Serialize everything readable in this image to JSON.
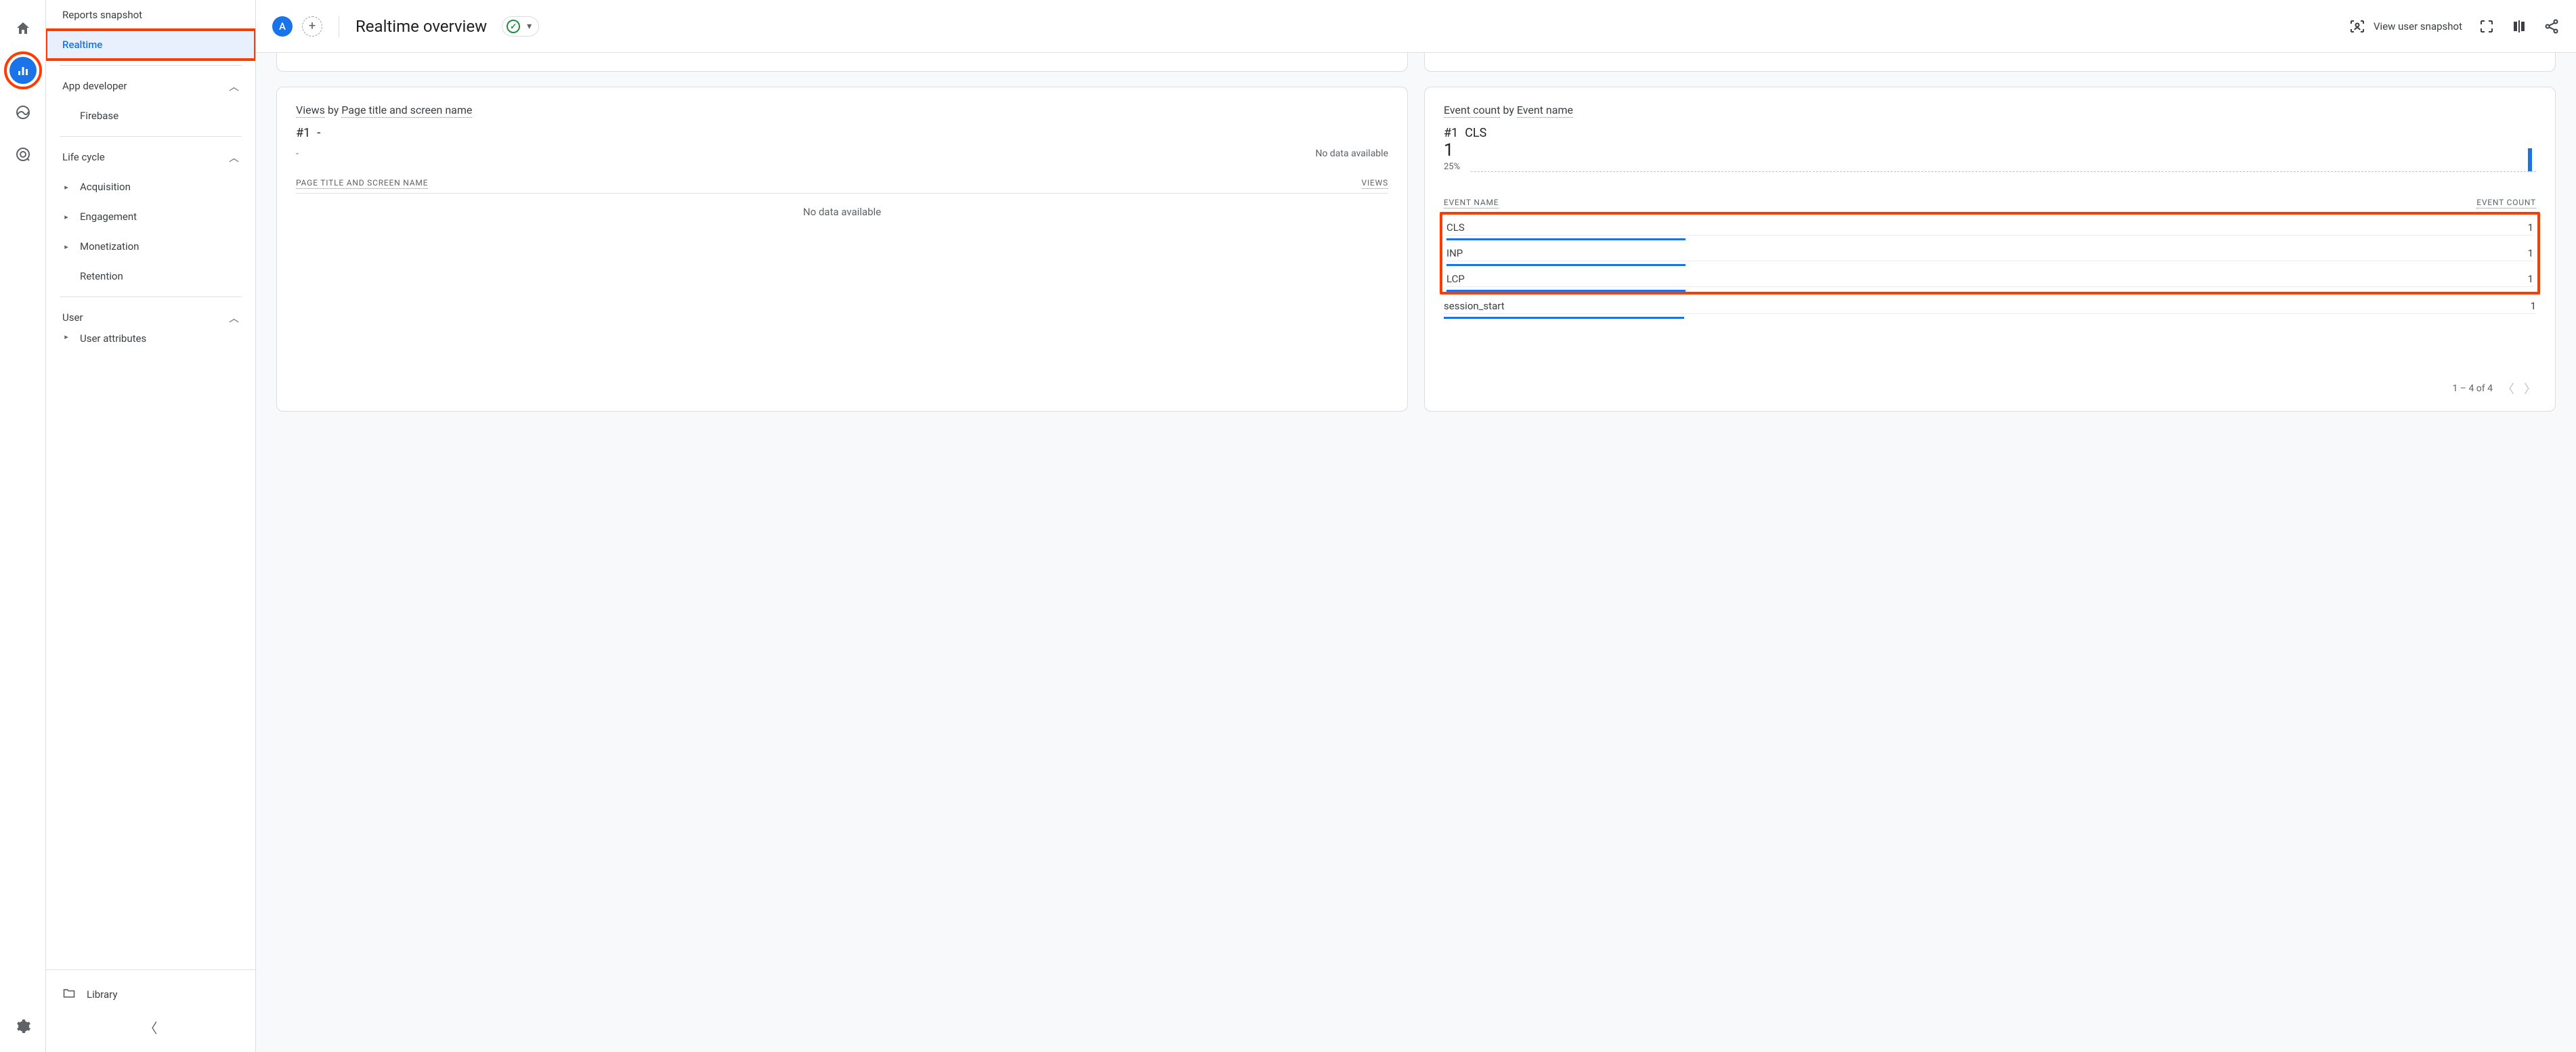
{
  "rail": {
    "items": [
      "home",
      "reports",
      "explore",
      "advertising"
    ],
    "active": "reports"
  },
  "sidenav": {
    "reports_snapshot": "Reports snapshot",
    "realtime": "Realtime",
    "groups": {
      "app_developer": {
        "label": "App developer",
        "items": [
          "Firebase"
        ]
      },
      "life_cycle": {
        "label": "Life cycle",
        "items": [
          "Acquisition",
          "Engagement",
          "Monetization",
          "Retention"
        ]
      },
      "user": {
        "label": "User",
        "items": [
          "User attributes"
        ]
      }
    },
    "library": "Library"
  },
  "header": {
    "chip": "A",
    "title": "Realtime overview",
    "snapshot": "View user snapshot"
  },
  "cards": {
    "views": {
      "title_pre": "Views",
      "title_by": " by ",
      "title_dim": "Page title and screen name",
      "rank_label": "#1",
      "rank_value": "-",
      "col_left": "PAGE TITLE AND SCREEN NAME",
      "col_right": "VIEWS",
      "no_data": "No data available",
      "dash": "-"
    },
    "events": {
      "title_pre": "Event count",
      "title_by": " by ",
      "title_dim": "Event name",
      "rank_label": "#1",
      "rank_value": "CLS",
      "big_value": "1",
      "pct": "25%",
      "col_left": "EVENT NAME",
      "col_right": "EVENT COUNT",
      "rows": [
        {
          "name": "CLS",
          "count": "1"
        },
        {
          "name": "INP",
          "count": "1"
        },
        {
          "name": "LCP",
          "count": "1"
        },
        {
          "name": "session_start",
          "count": "1"
        }
      ],
      "pager": "1 – 4 of 4"
    }
  },
  "chart_data": {
    "type": "bar",
    "title": "Event count by Event name",
    "xlabel": "Event name",
    "ylabel": "Event count",
    "categories": [
      "CLS",
      "INP",
      "LCP",
      "session_start"
    ],
    "values": [
      1,
      1,
      1,
      1
    ],
    "ylim": [
      0,
      1
    ]
  }
}
